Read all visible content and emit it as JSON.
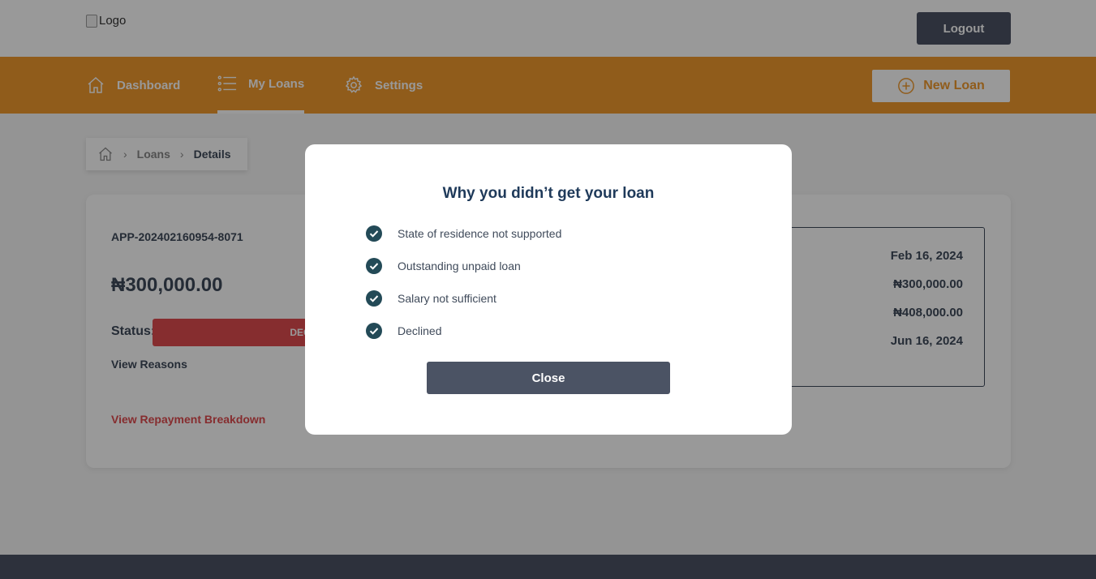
{
  "header": {
    "logo_alt": "Logo",
    "logout_label": "Logout"
  },
  "nav": {
    "items": [
      {
        "label": "Dashboard",
        "icon": "home-icon"
      },
      {
        "label": "My Loans",
        "icon": "list-icon",
        "active": true
      },
      {
        "label": "Settings",
        "icon": "gear-icon"
      }
    ],
    "new_loan_label": "New Loan"
  },
  "breadcrumb": {
    "items": [
      "Loans",
      "Details"
    ]
  },
  "loan": {
    "application_id": "APP-202402160954-8071",
    "amount": "₦300,000.00",
    "status_label": "Status:",
    "status_value": "DECLINED",
    "view_reasons_label": "View Reasons",
    "view_breakdown_label": "View Repayment Breakdown",
    "details": [
      "Feb 16, 2024",
      "₦300,000.00",
      "₦408,000.00",
      "Jun 16, 2024"
    ]
  },
  "modal": {
    "title": "Why you didn’t get your loan",
    "reasons": [
      "State of residence not supported",
      "Outstanding unpaid loan",
      "Salary not sufficient",
      "Declined"
    ],
    "close_label": "Close"
  },
  "colors": {
    "brand_orange": "#f1992d",
    "dark_slate": "#4b5364",
    "declined_red": "#e04b4f",
    "check_teal": "#234a57"
  }
}
